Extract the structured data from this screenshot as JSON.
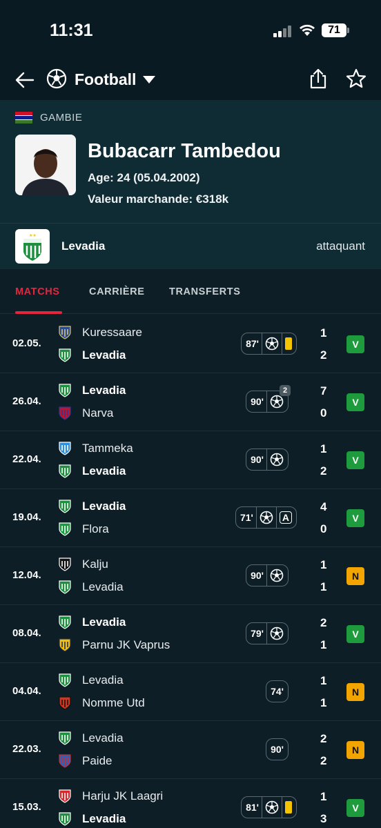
{
  "status_bar": {
    "time": "11:31",
    "battery": "71"
  },
  "nav": {
    "sport": "Football"
  },
  "player": {
    "country": "GAMBIE",
    "name": "Bubacarr Tambedou",
    "age": "Age: 24 (05.04.2002)",
    "market_value": "Valeur marchande: €318k",
    "club": "Levadia",
    "position": "attaquant"
  },
  "tabs": [
    "MATCHS",
    "CARRIÈRE",
    "TRANSFERTS"
  ],
  "colors": {
    "accent": "#e5263e",
    "win": "#1e9b3c",
    "draw": "#f2a500",
    "yellow_card": "#f5c400"
  },
  "matches": [
    {
      "date": "02.05.",
      "home": "Kuressaare",
      "away": "Levadia",
      "home_bold": false,
      "away_bold": true,
      "home_icon": "kuressaare-crest-icon",
      "away_icon": "levadia-crest-icon",
      "minutes": "87'",
      "ball": true,
      "yellow": true,
      "assist": "",
      "goals_badge": "",
      "home_score": "1",
      "away_score": "2",
      "result": "V"
    },
    {
      "date": "26.04.",
      "home": "Levadia",
      "away": "Narva",
      "home_bold": true,
      "away_bold": false,
      "home_icon": "levadia-crest-icon",
      "away_icon": "narva-crest-icon",
      "minutes": "90'",
      "ball": true,
      "yellow": false,
      "assist": "",
      "goals_badge": "2",
      "home_score": "7",
      "away_score": "0",
      "result": "V"
    },
    {
      "date": "22.04.",
      "home": "Tammeka",
      "away": "Levadia",
      "home_bold": false,
      "away_bold": true,
      "home_icon": "tammeka-crest-icon",
      "away_icon": "levadia-crest-icon",
      "minutes": "90'",
      "ball": true,
      "yellow": false,
      "assist": "",
      "goals_badge": "",
      "home_score": "1",
      "away_score": "2",
      "result": "V"
    },
    {
      "date": "19.04.",
      "home": "Levadia",
      "away": "Flora",
      "home_bold": true,
      "away_bold": false,
      "home_icon": "levadia-crest-icon",
      "away_icon": "flora-crest-icon",
      "minutes": "71'",
      "ball": true,
      "yellow": false,
      "assist": "A",
      "goals_badge": "",
      "home_score": "4",
      "away_score": "0",
      "result": "V"
    },
    {
      "date": "12.04.",
      "home": "Kalju",
      "away": "Levadia",
      "home_bold": false,
      "away_bold": false,
      "home_icon": "kalju-crest-icon",
      "away_icon": "levadia-crest-icon",
      "minutes": "90'",
      "ball": true,
      "yellow": false,
      "assist": "",
      "goals_badge": "",
      "home_score": "1",
      "away_score": "1",
      "result": "N"
    },
    {
      "date": "08.04.",
      "home": "Levadia",
      "away": "Parnu JK Vaprus",
      "home_bold": true,
      "away_bold": false,
      "home_icon": "levadia-crest-icon",
      "away_icon": "vaprus-crest-icon",
      "minutes": "79'",
      "ball": true,
      "yellow": false,
      "assist": "",
      "goals_badge": "",
      "home_score": "2",
      "away_score": "1",
      "result": "V"
    },
    {
      "date": "04.04.",
      "home": "Levadia",
      "away": "Nomme Utd",
      "home_bold": false,
      "away_bold": false,
      "home_icon": "levadia-crest-icon",
      "away_icon": "nomme-crest-icon",
      "minutes": "74'",
      "ball": false,
      "yellow": false,
      "assist": "",
      "goals_badge": "",
      "home_score": "1",
      "away_score": "1",
      "result": "N"
    },
    {
      "date": "22.03.",
      "home": "Levadia",
      "away": "Paide",
      "home_bold": false,
      "away_bold": false,
      "home_icon": "levadia-crest-icon",
      "away_icon": "paide-crest-icon",
      "minutes": "90'",
      "ball": false,
      "yellow": false,
      "assist": "",
      "goals_badge": "",
      "home_score": "2",
      "away_score": "2",
      "result": "N"
    },
    {
      "date": "15.03.",
      "home": "Harju JK Laagri",
      "away": "Levadia",
      "home_bold": false,
      "away_bold": true,
      "home_icon": "laagri-crest-icon",
      "away_icon": "levadia-crest-icon",
      "minutes": "81'",
      "ball": true,
      "yellow": true,
      "assist": "",
      "goals_badge": "",
      "home_score": "1",
      "away_score": "3",
      "result": "V"
    }
  ]
}
